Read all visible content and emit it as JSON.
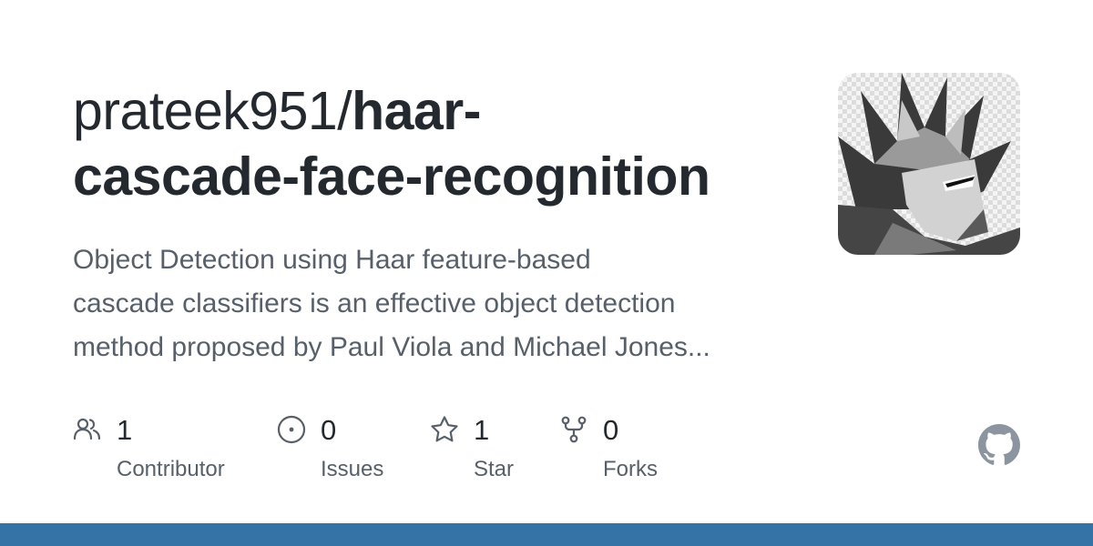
{
  "repo": {
    "owner": "prateek951/",
    "name_line1": "haar-",
    "name_line2": "cascade-face-recognition",
    "description_lines": [
      "Object Detection using Haar feature-based",
      "cascade classifiers is an effective object detection",
      "method proposed by Paul Viola and Michael Jones..."
    ]
  },
  "stats": {
    "contributors": {
      "count": "1",
      "label": "Contributor",
      "icon": "people-icon"
    },
    "issues": {
      "count": "0",
      "label": "Issues",
      "icon": "issue-opened-icon"
    },
    "stars": {
      "count": "1",
      "label": "Star",
      "icon": "star-icon"
    },
    "forks": {
      "count": "0",
      "label": "Forks",
      "icon": "repo-forked-icon"
    }
  },
  "avatar": {
    "icon": "owner-avatar-image"
  },
  "brand": {
    "icon": "github-mark-icon"
  },
  "colors": {
    "title": "#24292f",
    "description": "#57606a",
    "language_bar": "#3572a5"
  }
}
